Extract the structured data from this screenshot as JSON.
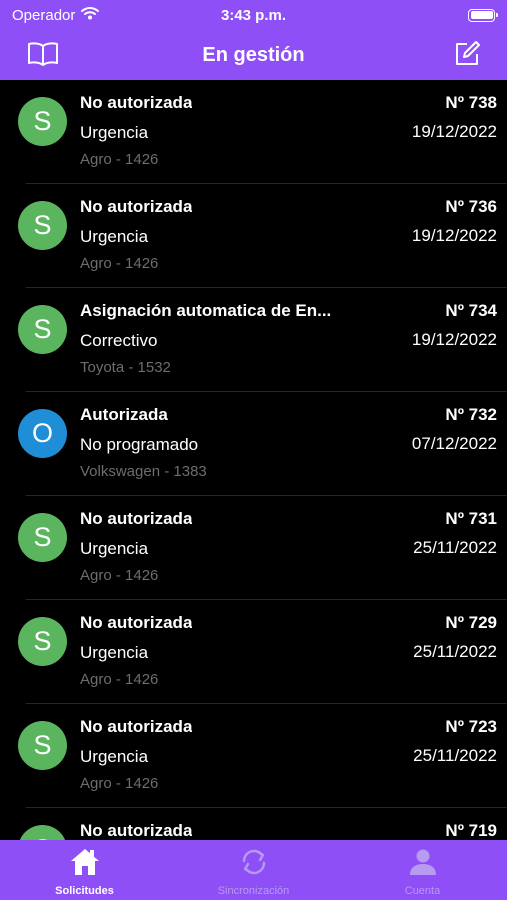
{
  "status_bar": {
    "carrier": "Operador",
    "time": "3:43 p.m."
  },
  "header": {
    "title": "En gestión"
  },
  "requests": [
    {
      "avatar_letter": "S",
      "avatar_color": "#5ab55e",
      "title": "No autorizada",
      "type": "Urgencia",
      "subtitle": "Agro - 1426",
      "number": "Nº 738",
      "date": "19/12/2022"
    },
    {
      "avatar_letter": "S",
      "avatar_color": "#5ab55e",
      "title": "No autorizada",
      "type": "Urgencia",
      "subtitle": "Agro - 1426",
      "number": "Nº 736",
      "date": "19/12/2022"
    },
    {
      "avatar_letter": "S",
      "avatar_color": "#5ab55e",
      "title": "Asignación automatica de En...",
      "type": "Correctivo",
      "subtitle": "Toyota - 1532",
      "number": "Nº 734",
      "date": "19/12/2022"
    },
    {
      "avatar_letter": "O",
      "avatar_color": "#1f8ed6",
      "title": "Autorizada",
      "type": "No programado",
      "subtitle": "Volkswagen - 1383",
      "number": "Nº 732",
      "date": "07/12/2022"
    },
    {
      "avatar_letter": "S",
      "avatar_color": "#5ab55e",
      "title": "No autorizada",
      "type": "Urgencia",
      "subtitle": "Agro - 1426",
      "number": "Nº 731",
      "date": "25/11/2022"
    },
    {
      "avatar_letter": "S",
      "avatar_color": "#5ab55e",
      "title": "No autorizada",
      "type": "Urgencia",
      "subtitle": "Agro - 1426",
      "number": "Nº 729",
      "date": "25/11/2022"
    },
    {
      "avatar_letter": "S",
      "avatar_color": "#5ab55e",
      "title": "No autorizada",
      "type": "Urgencia",
      "subtitle": "Agro - 1426",
      "number": "Nº 723",
      "date": "25/11/2022"
    },
    {
      "avatar_letter": "S",
      "avatar_color": "#5ab55e",
      "title": "No autorizada",
      "type": "",
      "subtitle": "",
      "number": "Nº 719",
      "date": ""
    }
  ],
  "tabs": [
    {
      "label": "Solicitudes",
      "icon": "home-icon",
      "active": true
    },
    {
      "label": "Sincronización",
      "icon": "sync-icon",
      "active": false
    },
    {
      "label": "Cuenta",
      "icon": "person-icon",
      "active": false
    }
  ],
  "colors": {
    "accent": "#8f4ff7",
    "background": "#000000",
    "success": "#5ab55e",
    "info": "#1f8ed6"
  }
}
